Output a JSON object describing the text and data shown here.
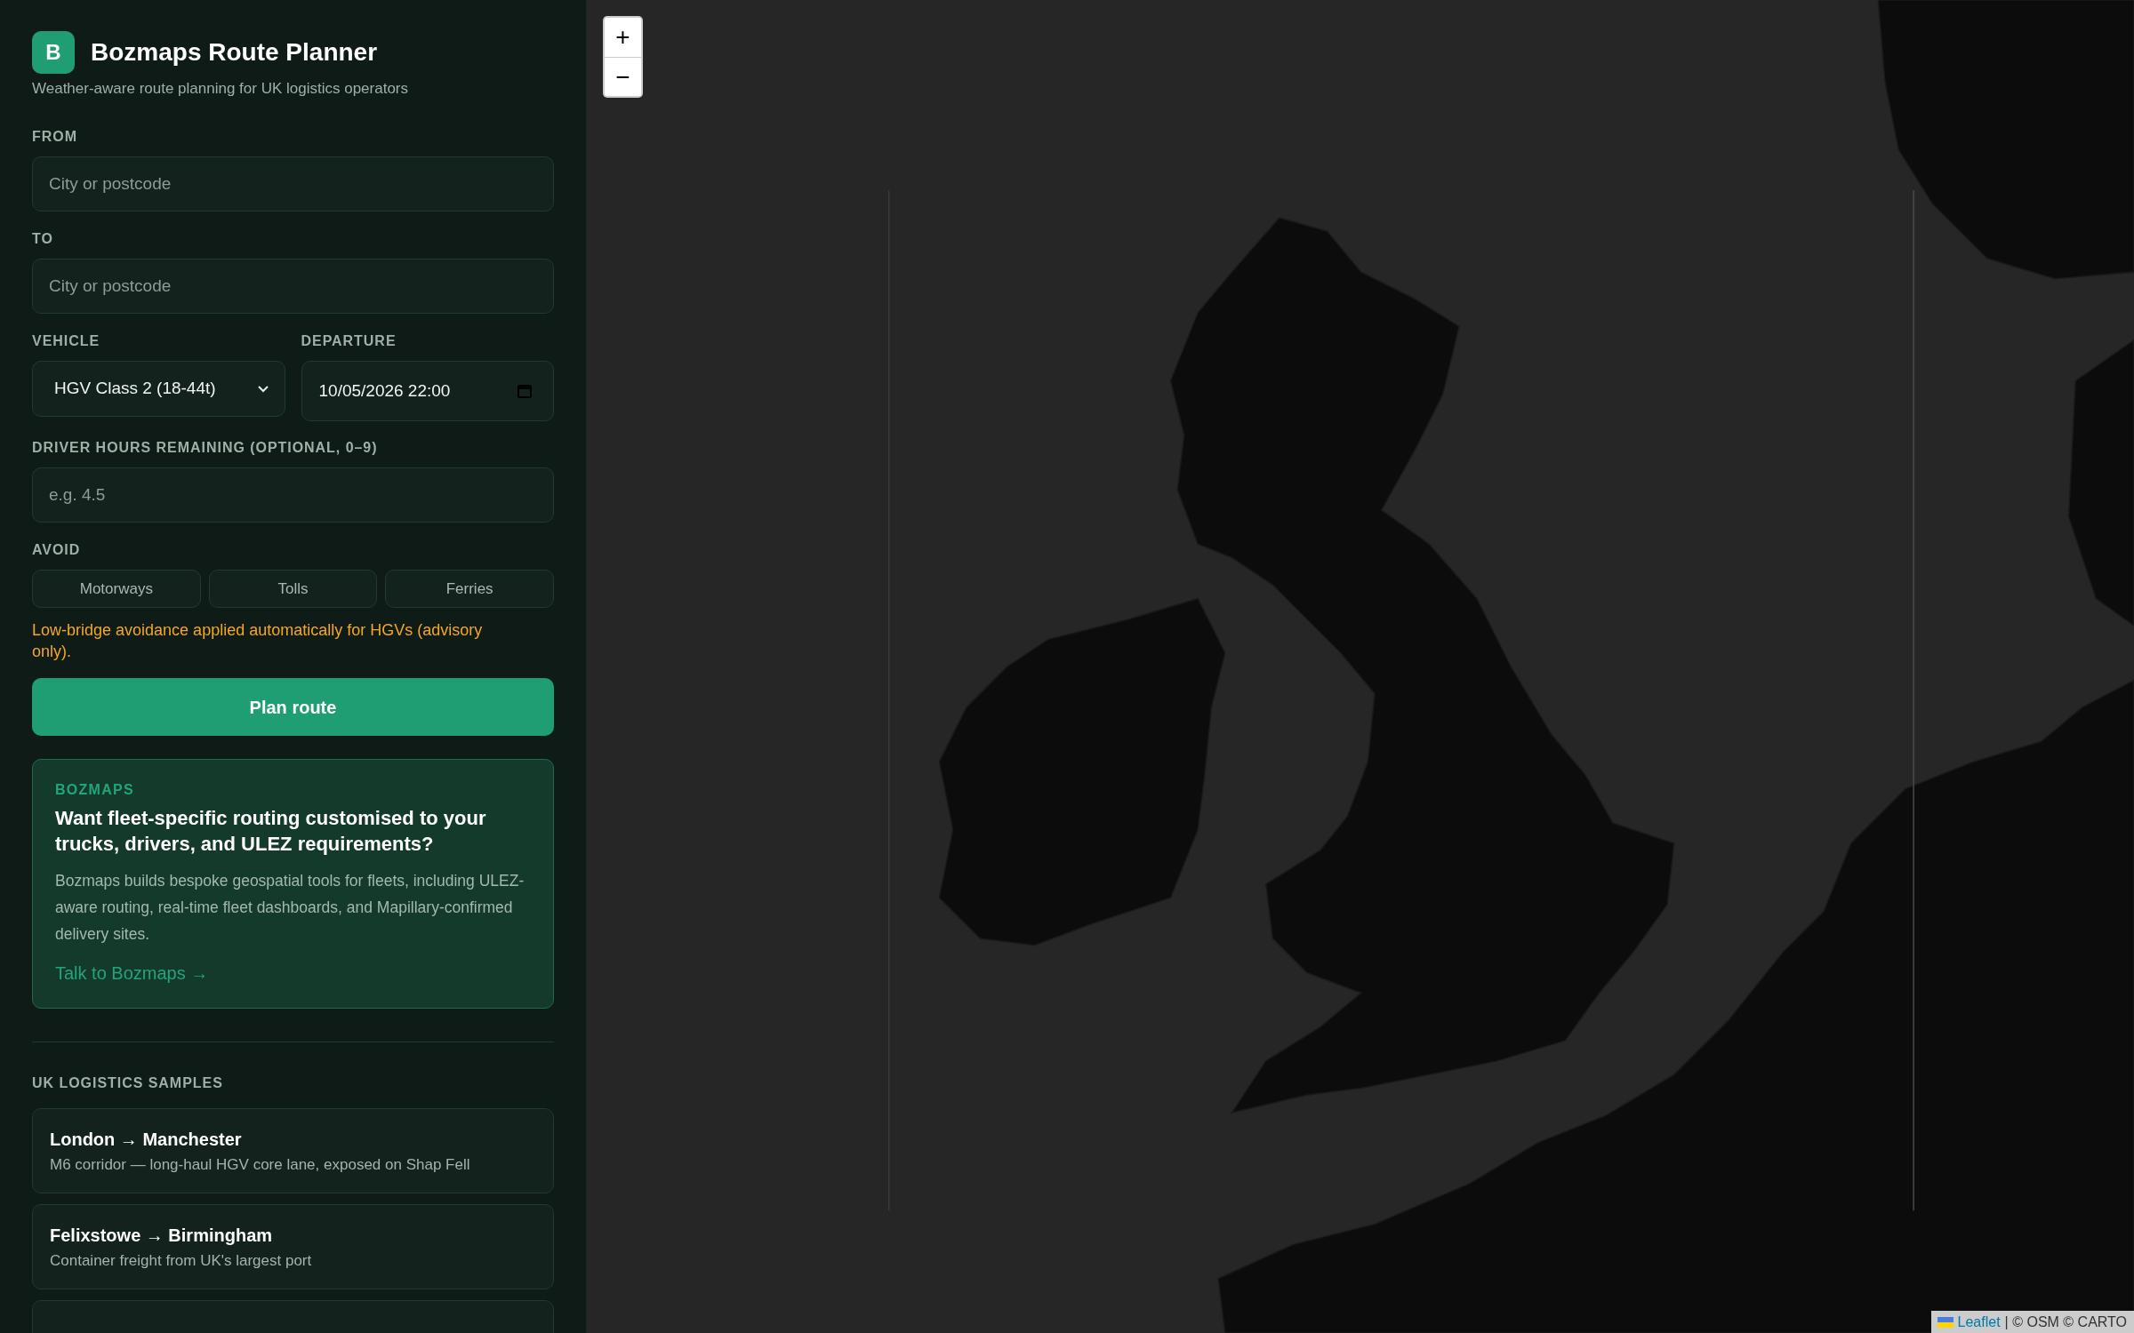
{
  "brand": {
    "logo_letter": "B",
    "title": "Bozmaps Route Planner",
    "subtitle": "Weather-aware route planning for UK logistics operators"
  },
  "form": {
    "from": {
      "label": "FROM",
      "placeholder": "City or postcode"
    },
    "to": {
      "label": "TO",
      "placeholder": "City or postcode"
    },
    "vehicle": {
      "label": "VEHICLE",
      "value": "HGV Class 2 (18-44t)"
    },
    "departure": {
      "label": "DEPARTURE",
      "value": "10/05/2026 22:00"
    },
    "driver_hours": {
      "label": "DRIVER HOURS REMAINING (OPTIONAL, 0–9)",
      "placeholder": "e.g. 4.5"
    },
    "avoid": {
      "label": "AVOID",
      "options": [
        {
          "label": "Motorways",
          "selected": false
        },
        {
          "label": "Tolls",
          "selected": false
        },
        {
          "label": "Ferries",
          "selected": false
        }
      ]
    },
    "notice": "Low-bridge avoidance applied automatically for HGVs (advisory only).",
    "submit": "Plan route"
  },
  "promo": {
    "eyebrow": "BOZMAPS",
    "heading": "Want fleet-specific routing customised to your trucks, drivers, and ULEZ requirements?",
    "body": "Bozmaps builds bespoke geospatial tools for fleets, including ULEZ-aware routing, real-time fleet dashboards, and Mapillary-confirmed delivery sites.",
    "link": "Talk to Bozmaps →"
  },
  "samples": {
    "heading": "UK LOGISTICS SAMPLES",
    "items": [
      {
        "title": "London → Manchester",
        "description": "M6 corridor — long-haul HGV core lane, exposed on Shap Fell"
      },
      {
        "title": "Felixstowe → Birmingham",
        "description": "Container freight from UK's largest port"
      }
    ],
    "more_below": true
  },
  "map": {
    "zoom_controls": [
      "+",
      "−"
    ],
    "attribution": {
      "link": "Leaflet",
      "text": "| © OSM © CARTO"
    }
  }
}
